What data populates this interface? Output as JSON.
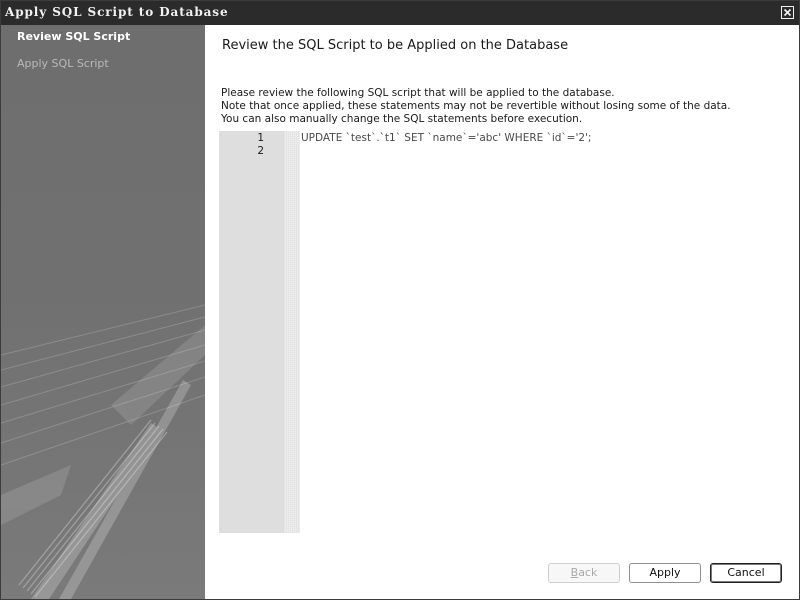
{
  "window": {
    "title": "Apply SQL Script to Database"
  },
  "sidebar": {
    "steps": [
      {
        "label": "Review SQL Script",
        "active": true
      },
      {
        "label": "Apply SQL Script",
        "active": false
      }
    ]
  },
  "main": {
    "heading": "Review the SQL Script to be Applied on the Database",
    "description": [
      "Please review the following SQL script that will be applied to the database.",
      "Note that once applied, these statements may not be revertible without losing some of the data.",
      "You can also manually change the SQL statements before execution."
    ],
    "editor": {
      "line_numbers": [
        "1",
        "2"
      ],
      "code": "UPDATE `test`.`t1` SET `name`='abc' WHERE `id`='2';"
    }
  },
  "buttons": {
    "back": {
      "label": "Back",
      "mnemonic": "B",
      "enabled": false
    },
    "apply": {
      "label": "Apply",
      "enabled": true
    },
    "cancel": {
      "label": "Cancel",
      "enabled": true,
      "default": true
    }
  },
  "colors": {
    "titlebar": "#2b2b2b",
    "sidebar": "#707070",
    "gutter": "#dedede"
  },
  "icons": {
    "close": "close-icon"
  }
}
